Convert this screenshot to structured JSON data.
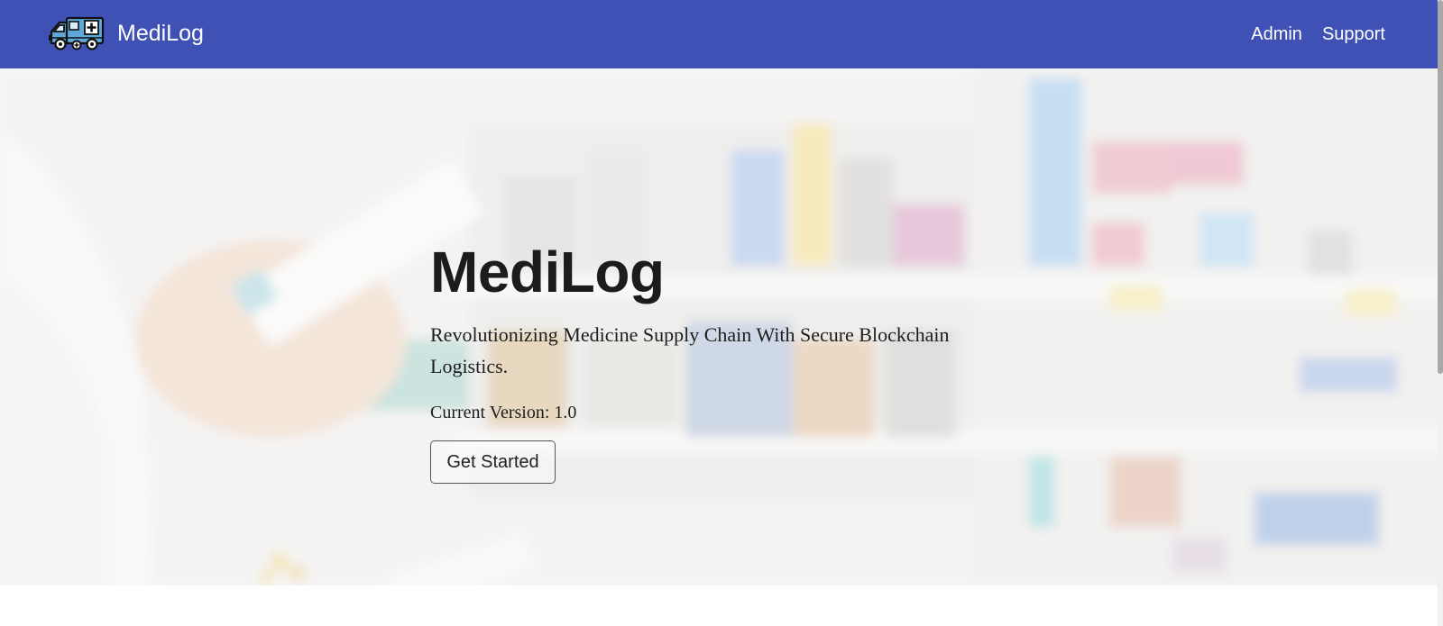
{
  "navbar": {
    "brand_name": "MediLog",
    "brand_icon": "ambulance-icon",
    "links": [
      {
        "label": "Admin"
      },
      {
        "label": "Support"
      }
    ],
    "background_color": "#3f51b5"
  },
  "hero": {
    "title": "MediLog",
    "subtitle": "Revolutionizing Medicine Supply Chain With Secure Blockchain Logistics.",
    "version_label": "Current Version:",
    "version_value": "1.0",
    "cta_label": "Get Started"
  }
}
